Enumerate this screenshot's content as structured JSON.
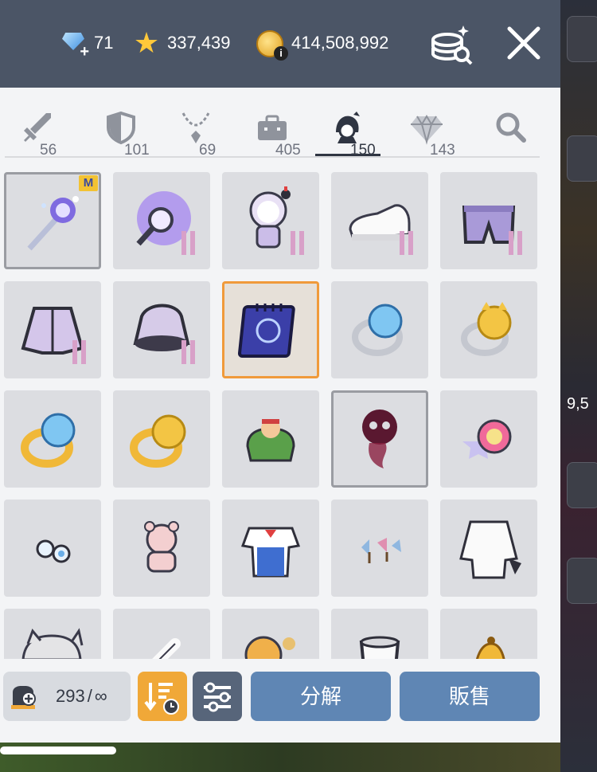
{
  "currencies": {
    "diamonds": "71",
    "stars": "337,439",
    "coins": "414,508,992"
  },
  "tabs": [
    {
      "icon": "sword-icon",
      "count": "56",
      "active": false
    },
    {
      "icon": "shield-icon",
      "count": "101",
      "active": false
    },
    {
      "icon": "necklace-icon",
      "count": "69",
      "active": false
    },
    {
      "icon": "briefcase-icon",
      "count": "405",
      "active": false
    },
    {
      "icon": "character-head-icon",
      "count": "150",
      "active": true
    },
    {
      "icon": "diamond-icon",
      "count": "143",
      "active": false
    },
    {
      "icon": "search-icon",
      "count": "",
      "active": false
    }
  ],
  "items": [
    {
      "name": "magic-wand",
      "badge": "M"
    },
    {
      "name": "purple-magnifier",
      "badge": ""
    },
    {
      "name": "astronaut-costume",
      "badge": ""
    },
    {
      "name": "white-sneaker",
      "badge": ""
    },
    {
      "name": "purple-shorts",
      "badge": ""
    },
    {
      "name": "purple-jacket",
      "badge": ""
    },
    {
      "name": "purple-bucket-hat",
      "badge": ""
    },
    {
      "name": "blue-spellbook",
      "badge": ""
    },
    {
      "name": "blue-slime-ring",
      "badge": ""
    },
    {
      "name": "gold-cat-ring",
      "badge": ""
    },
    {
      "name": "gold-slime-ring",
      "badge": ""
    },
    {
      "name": "gold-cat-ring-2",
      "badge": ""
    },
    {
      "name": "green-frog-pouch",
      "badge": ""
    },
    {
      "name": "dark-skull-shadow",
      "badge": ""
    },
    {
      "name": "rainbow-orb-trinket",
      "badge": ""
    },
    {
      "name": "blue-earrings",
      "badge": ""
    },
    {
      "name": "pink-teddy-bear",
      "badge": ""
    },
    {
      "name": "sailor-outfit",
      "badge": ""
    },
    {
      "name": "pinwheel-ornament",
      "badge": ""
    },
    {
      "name": "white-coat",
      "badge": ""
    },
    {
      "name": "grey-cat",
      "badge": ""
    },
    {
      "name": "white-bone",
      "badge": ""
    },
    {
      "name": "tiger-cat-toy",
      "badge": ""
    },
    {
      "name": "white-cup",
      "badge": ""
    },
    {
      "name": "gold-bell",
      "badge": ""
    }
  ],
  "capacity": {
    "used": "293",
    "separator": "/",
    "max": "∞"
  },
  "buttons": {
    "disassemble": "分解",
    "sell": "販售"
  },
  "background": {
    "partial_number": "9,5"
  },
  "colors": {
    "topbar": "#4b5566",
    "selected_orange": "#f09a3a",
    "sort_button": "#f0a838",
    "action_button": "#5f86b4"
  }
}
